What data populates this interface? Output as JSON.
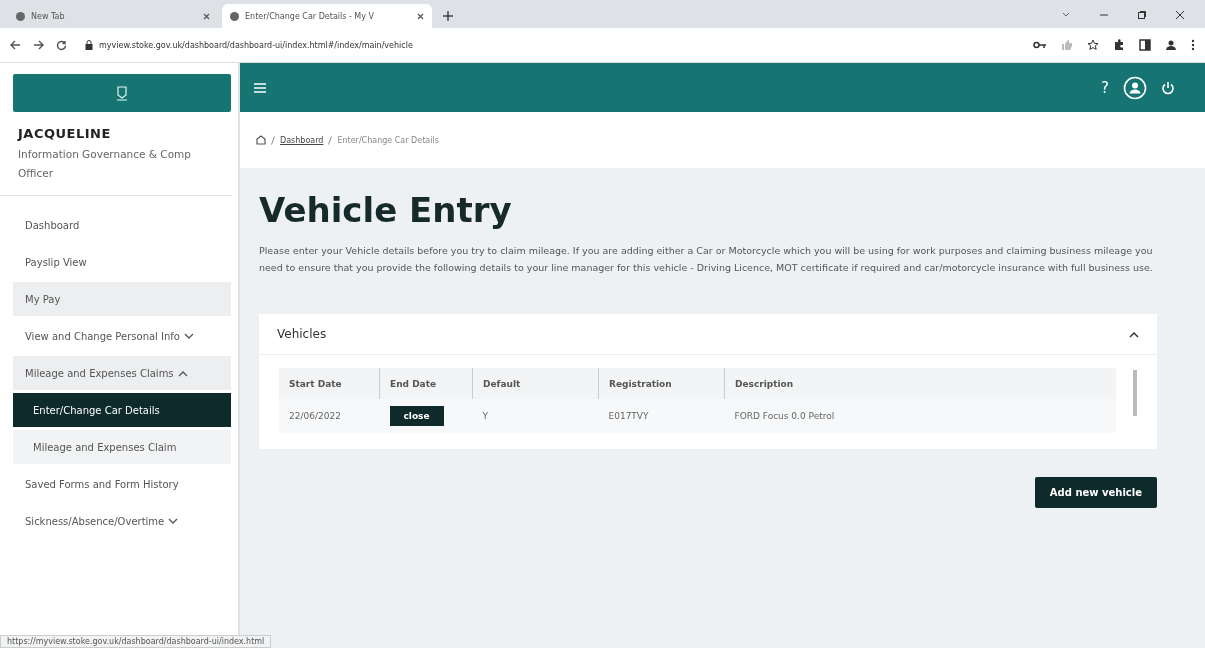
{
  "browser": {
    "tabs": [
      {
        "title": "New Tab",
        "selected": false
      },
      {
        "title": "Enter/Change Car Details - My V",
        "selected": true
      }
    ],
    "url": "myview.stoke.gov.uk/dashboard/dashboard-ui/index.html#/index/main/vehicle"
  },
  "header": {
    "help": "?"
  },
  "sidebar": {
    "user_name": "JACQUELINE",
    "user_role": "Information Governance & Comp Officer",
    "items": [
      {
        "label": "Dashboard",
        "selected": false,
        "hovered": false
      },
      {
        "label": "Payslip View",
        "selected": false,
        "hovered": false
      },
      {
        "label": "My Pay",
        "selected": false,
        "hovered": true
      },
      {
        "label": "View and Change Personal Info",
        "selected": false,
        "hovered": false,
        "expanded": false
      },
      {
        "label": "Mileage and Expenses Claims",
        "selected": false,
        "hovered": false,
        "expanded": true,
        "children": [
          {
            "label": "Enter/Change Car Details",
            "selected": true
          },
          {
            "label": "Mileage and Expenses Claim",
            "selected": false
          }
        ]
      },
      {
        "label": "Saved Forms and Form History",
        "selected": false,
        "hovered": false
      },
      {
        "label": "Sickness/Absence/Overtime",
        "selected": false,
        "hovered": false,
        "expanded": false
      }
    ]
  },
  "breadcrumb": [
    "Dashboard",
    "Enter/Change Car Details"
  ],
  "page": {
    "title": "Vehicle Entry",
    "intro": "Please enter your Vehicle details before you try to claim mileage. If you are adding either a Car or Motorcycle which you will be using for work purposes and claiming business mileage you need to ensure that you provide the following details to your line manager for this vehicle - Driving Licence, MOT certificate if required and car/motorcycle insurance with full business use."
  },
  "vehicles": {
    "title": "Vehicles",
    "expanded": true,
    "columns": [
      "Start Date",
      "End Date",
      "Default",
      "Registration",
      "Description"
    ],
    "rows": [
      {
        "start_date": "22/06/2022",
        "end_action": "close",
        "default": "Y",
        "registration": "E017TVY",
        "description": "FORD Focus 0.0 Petrol"
      }
    ]
  },
  "add_button": "Add new vehicle",
  "status_bar": "https://myview.stoke.gov.uk/dashboard/dashboard-ui/index.html"
}
